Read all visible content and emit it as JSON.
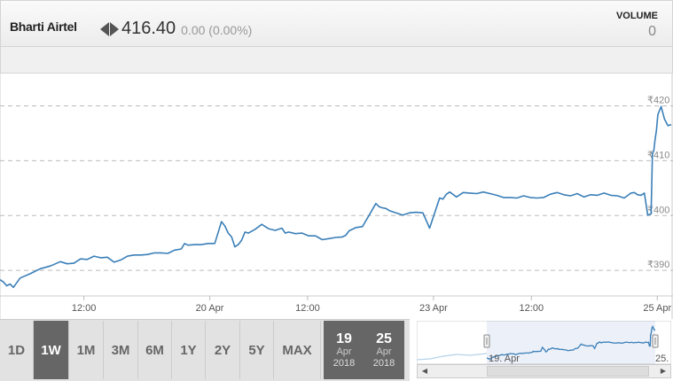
{
  "header": {
    "stock_name": "Bharti Airtel",
    "price": "416.40",
    "change": "0.00 (0.00%)",
    "volume_label": "VOLUME",
    "volume_value": "0"
  },
  "chart_data": {
    "type": "line",
    "title": "",
    "xlabel": "",
    "ylabel": "",
    "ylim": [
      385.5,
      423
    ],
    "y_ticks": [
      {
        "value": 420,
        "label": "₹420"
      },
      {
        "value": 410,
        "label": "₹410"
      },
      {
        "value": 400,
        "label": "₹400"
      },
      {
        "value": 390,
        "label": "₹390"
      }
    ],
    "x_ticks": [
      {
        "at": 0.125,
        "label": "12:00"
      },
      {
        "at": 0.3125,
        "label": "20 Apr"
      },
      {
        "at": 0.4583,
        "label": "12:00"
      },
      {
        "at": 0.6458,
        "label": "23 Apr"
      },
      {
        "at": 0.7917,
        "label": "12:00"
      },
      {
        "at": 0.9792,
        "label": "25 Apr"
      }
    ],
    "grid": "horizontal-dashed",
    "line_color": "#3a7fb8",
    "series": [
      {
        "x": [
          0,
          0.005,
          0.01,
          0.015,
          0.02,
          0.03,
          0.045,
          0.06,
          0.075,
          0.09,
          0.1,
          0.11,
          0.12,
          0.13,
          0.14,
          0.15,
          0.16,
          0.17,
          0.18,
          0.19,
          0.2,
          0.21,
          0.22,
          0.23,
          0.24,
          0.25,
          0.26,
          0.27,
          0.275,
          0.28,
          0.29,
          0.3,
          0.31,
          0.32,
          0.33,
          0.335,
          0.34,
          0.345,
          0.35,
          0.355,
          0.36,
          0.365,
          0.37,
          0.38,
          0.39,
          0.4,
          0.41,
          0.42,
          0.425,
          0.43,
          0.44,
          0.45,
          0.46,
          0.47,
          0.48,
          0.49,
          0.5,
          0.51,
          0.515,
          0.52,
          0.53,
          0.54,
          0.55,
          0.56,
          0.565,
          0.57,
          0.575,
          0.58,
          0.59,
          0.6,
          0.61,
          0.62,
          0.63,
          0.64,
          0.655,
          0.66,
          0.665,
          0.67,
          0.68,
          0.69,
          0.7,
          0.71,
          0.72,
          0.73,
          0.74,
          0.75,
          0.76,
          0.77,
          0.78,
          0.79,
          0.8,
          0.81,
          0.82,
          0.83,
          0.84,
          0.85,
          0.86,
          0.87,
          0.88,
          0.89,
          0.9,
          0.91,
          0.92,
          0.93,
          0.94,
          0.945,
          0.95,
          0.955,
          0.96,
          0.965,
          0.97,
          0.972,
          0.974,
          0.976,
          0.978,
          0.98,
          0.985,
          0.99,
          0.995,
          1.0
        ],
        "y": [
          388.3,
          387.9,
          387.2,
          387.5,
          386.9,
          388.6,
          389.4,
          390.3,
          390.8,
          391.6,
          391.2,
          391.3,
          392.1,
          392.0,
          392.6,
          392.3,
          392.4,
          391.5,
          391.9,
          392.6,
          392.8,
          392.8,
          392.9,
          393.2,
          393.2,
          393.1,
          393.7,
          393.9,
          394.9,
          394.6,
          394.7,
          394.7,
          394.9,
          394.9,
          398.9,
          398.1,
          396.8,
          396.1,
          394.3,
          394.7,
          395.5,
          397.0,
          396.8,
          397.5,
          398.4,
          397.6,
          397.3,
          397.7,
          396.8,
          397.0,
          396.7,
          396.8,
          396.3,
          396.3,
          395.6,
          395.8,
          396.0,
          396.1,
          396.4,
          397.2,
          397.8,
          398.0,
          400.1,
          402.2,
          401.6,
          401.4,
          401.3,
          400.9,
          400.5,
          400.1,
          400.5,
          400.6,
          400.5,
          397.7,
          403.2,
          403.0,
          403.9,
          404.3,
          403.4,
          404.2,
          404.1,
          404.0,
          404.3,
          404.0,
          403.7,
          403.3,
          403.3,
          403.2,
          403.6,
          403.3,
          403.2,
          403.3,
          403.9,
          404.2,
          403.8,
          403.6,
          404.0,
          403.4,
          403.8,
          403.7,
          404.1,
          403.7,
          403.6,
          403.2,
          404.1,
          404.2,
          403.8,
          403.7,
          404.1,
          400.1,
          400.3,
          411.3,
          411.8,
          413.9,
          415.5,
          418.4,
          419.9,
          417.6,
          416.4,
          416.6
        ]
      }
    ]
  },
  "toolbar": {
    "ranges": [
      "1D",
      "1W",
      "1M",
      "3M",
      "6M",
      "1Y",
      "2Y",
      "5Y",
      "MAX"
    ],
    "active_range": "1W",
    "from_date": {
      "day": "19",
      "month": "Apr",
      "year": "2018"
    },
    "to_date": {
      "day": "25",
      "month": "Apr",
      "year": "2018"
    }
  },
  "navigator": {
    "start_label": "19. Apr",
    "end_label": "25."
  }
}
